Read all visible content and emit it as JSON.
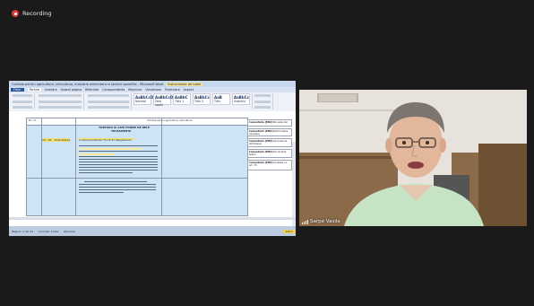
{
  "recording": {
    "label": "Recording"
  },
  "word": {
    "title": "Comisia pentru agricultura, silvicultura, industrie alimentara si servicii specifice - Microsoft Word",
    "title_highlight": "Instrumente de tabel",
    "tabs": [
      "Fisier",
      "Pornire",
      "Inserare",
      "Aspect pagina",
      "Referinte",
      "Corespondenta",
      "Revizuire",
      "Vizualizare",
      "Proiectare",
      "Aspect"
    ],
    "active_tab": "Pornire",
    "style_items": [
      {
        "sample": "AaBbCcDc",
        "name": "Normal"
      },
      {
        "sample": "AaBbCcDc",
        "name": "Fara spatii"
      },
      {
        "sample": "AaBbC",
        "name": "Titlu 1"
      },
      {
        "sample": "AaBbCc",
        "name": "Titlu 2"
      },
      {
        "sample": "AaB",
        "name": "Titlu"
      },
      {
        "sample": "AaBbCc",
        "name": "Subtitlu"
      }
    ],
    "table": {
      "header_left": "Nr. crt.",
      "header_right": "Comisia pentru agricultura, silvicultura",
      "title_line1": "TORTURA SI ALTE FORME DE RELE",
      "title_line2": "TRATAMENTE",
      "art_label": "Art. 76. - Exercitarea",
      "paragraph_intro": "In sensul prezentei 75-76 din Regulament"
    },
    "comments": [
      {
        "label": "Comentariu [MS1]",
        "text": "Nu este clar"
      },
      {
        "label": "Comentariu [MS2]",
        "text": "Reformulare necesara"
      },
      {
        "label": "Comentariu [MS3]",
        "text": "Se propune eliminarea"
      },
      {
        "label": "Comentariu [MS4]",
        "text": "De revizuit textul"
      },
      {
        "label": "Comentariu [MS5]",
        "text": "Corelare cu art. 75"
      }
    ],
    "status": {
      "page": "Pagina: 1 din 21",
      "words": "Cuvinte: 5.012",
      "language": "Romana",
      "zoom": "100%"
    }
  },
  "participant": {
    "name": "Sarpe Vasile"
  },
  "colors": {
    "background": "#1a1a1a",
    "accent": "#e03b2f"
  }
}
